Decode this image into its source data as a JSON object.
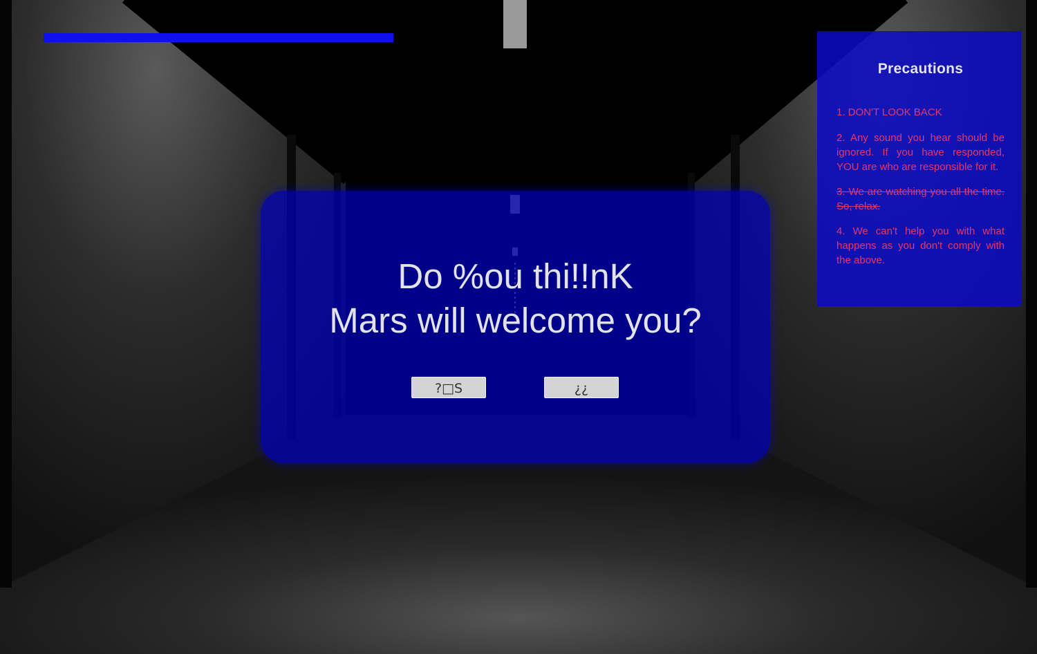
{
  "game": {
    "progress": 0.58,
    "accent_color": "#1010ee",
    "rule_color": "#e4386a"
  },
  "dialog": {
    "question_line1": "Do %ou thi!!nK",
    "question_line2": "Mars will welcome you?",
    "yes_label": "?□S",
    "no_label": "¿¿"
  },
  "precautions": {
    "title": "Precautions",
    "rules": [
      "1. DON'T LOOK BACK",
      "2. Any sound you hear should be ignored. If you have responded, YOU are who are responsible for it.",
      "3. We are watching you all the time. So, relax.",
      "4. We can't help you with what happens as you don't comply with the above."
    ],
    "struck_rule_index": 2
  }
}
